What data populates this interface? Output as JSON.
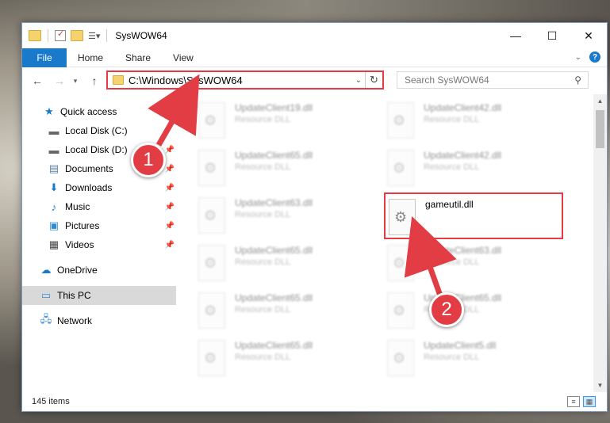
{
  "window": {
    "title": "SysWOW64",
    "controls": {
      "minimize": "—",
      "maximize": "☐",
      "close": "✕"
    }
  },
  "ribbon": {
    "file_label": "File",
    "tabs": [
      "Home",
      "Share",
      "View"
    ]
  },
  "navigation": {
    "address_path": "C:\\Windows\\SysWOW64",
    "search_placeholder": "Search SysWOW64"
  },
  "sidebar": {
    "items": [
      {
        "label": "Quick access",
        "icon": "star-icon"
      },
      {
        "label": "Local Disk (C:)",
        "icon": "drive-icon"
      },
      {
        "label": "Local Disk (D:)",
        "icon": "drive-icon",
        "pinned": true
      },
      {
        "label": "Documents",
        "icon": "documents-icon",
        "pinned": true
      },
      {
        "label": "Downloads",
        "icon": "download-icon",
        "pinned": true
      },
      {
        "label": "Music",
        "icon": "music-icon",
        "pinned": true
      },
      {
        "label": "Pictures",
        "icon": "pictures-icon",
        "pinned": true
      },
      {
        "label": "Videos",
        "icon": "videos-icon",
        "pinned": true
      },
      {
        "label": "OneDrive",
        "icon": "cloud-icon"
      },
      {
        "label": "This PC",
        "icon": "pc-icon",
        "selected": true
      },
      {
        "label": "Network",
        "icon": "network-icon"
      }
    ]
  },
  "files": [
    {
      "name": "UpdateClient19.dll",
      "type": "Resource DLL"
    },
    {
      "name": "UpdateClient42.dll",
      "type": "Resource DLL"
    },
    {
      "name": "UpdateClient65.dll",
      "type": "Resource DLL"
    },
    {
      "name": "UpdateClient42.dll",
      "type": "Resource DLL"
    },
    {
      "name": "UpdateClient63.dll",
      "type": "Resource DLL"
    },
    {
      "name": "gameutil.dll",
      "type": ""
    },
    {
      "name": "UpdateClient65.dll",
      "type": "Resource DLL"
    },
    {
      "name": "UpdateClient63.dll",
      "type": "Resource DLL"
    },
    {
      "name": "UpdateClient65.dll",
      "type": "Resource DLL"
    },
    {
      "name": "UpdateClient65.dll",
      "type": "Resource DLL"
    },
    {
      "name": "UpdateClient65.dll",
      "type": "Resource DLL"
    },
    {
      "name": "UpdateClient5.dll",
      "type": "Resource DLL"
    }
  ],
  "status": {
    "item_count": "145 items"
  },
  "annotations": {
    "step1": "1",
    "step2": "2",
    "color": "#e23c45"
  }
}
